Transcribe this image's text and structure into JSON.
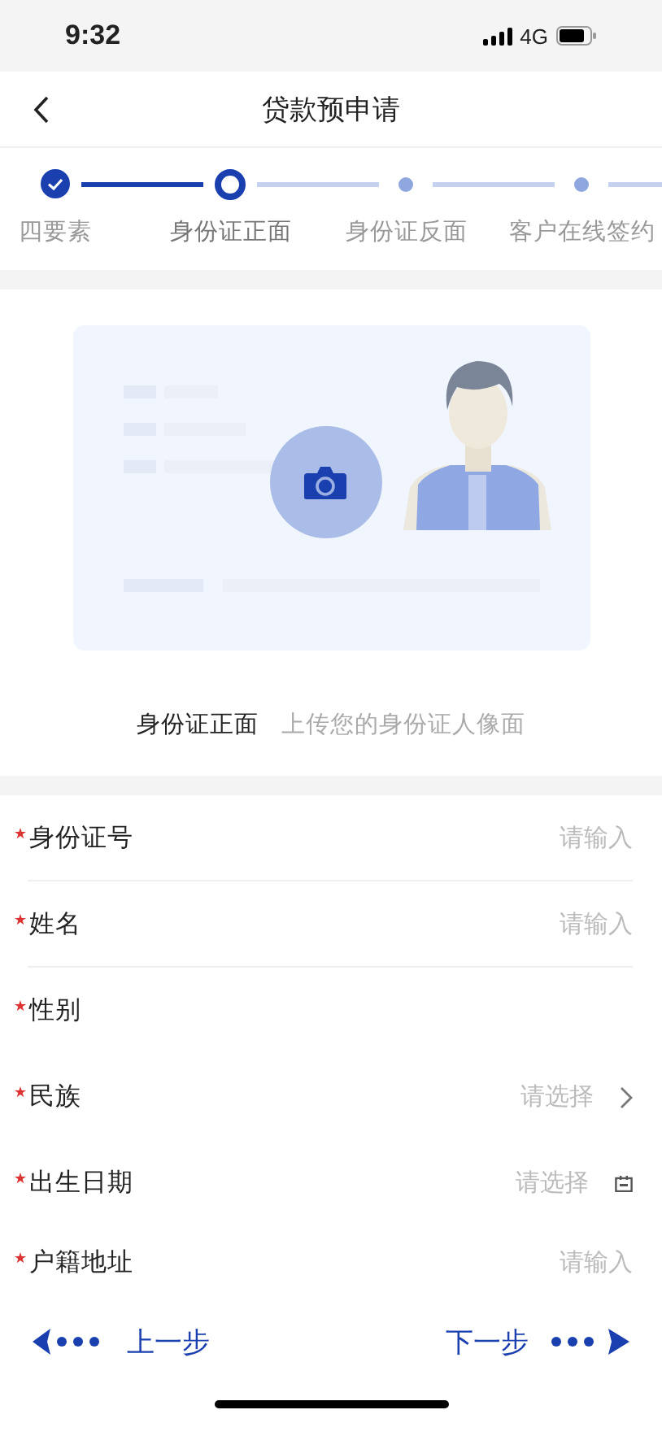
{
  "status_bar": {
    "time": "9:32",
    "network": "4G"
  },
  "header": {
    "title": "贷款预申请"
  },
  "steps": [
    {
      "label": "四要素",
      "done": true,
      "selected": false
    },
    {
      "label": "身份证正面",
      "done": false,
      "selected": true
    },
    {
      "label": "身份证反面",
      "done": false,
      "selected": false
    },
    {
      "label": "客户在线签约",
      "done": false,
      "selected": false
    }
  ],
  "upload": {
    "title": "身份证正面",
    "hint": "上传您的身份证人像面"
  },
  "fields": [
    {
      "label": "身份证号",
      "required": true,
      "kind": "input",
      "placeholder": "请输入"
    },
    {
      "label": "姓名",
      "required": true,
      "kind": "input",
      "placeholder": "请输入"
    },
    {
      "label": "性别",
      "required": true,
      "kind": "choice"
    },
    {
      "label": "民族",
      "required": true,
      "kind": "select",
      "placeholder": "请选择"
    },
    {
      "label": "出生日期",
      "required": true,
      "kind": "date",
      "placeholder": "请选择"
    },
    {
      "label": "户籍地址",
      "required": true,
      "kind": "input",
      "placeholder": "请输入"
    }
  ],
  "nav": {
    "prev": "上一步",
    "next": "下一步"
  }
}
